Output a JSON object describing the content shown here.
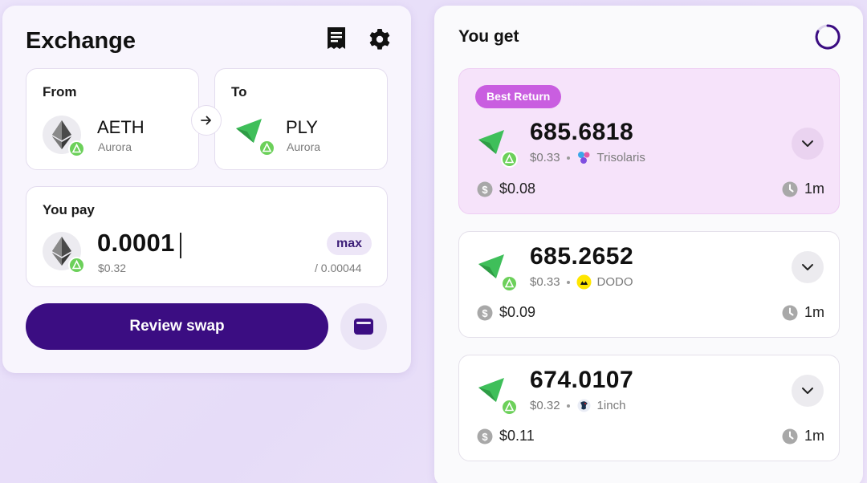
{
  "exchange": {
    "title": "Exchange",
    "from": {
      "label": "From",
      "symbol": "AETH",
      "chain": "Aurora"
    },
    "to": {
      "label": "To",
      "symbol": "PLY",
      "chain": "Aurora"
    },
    "pay": {
      "label": "You pay",
      "amount": "0.0001",
      "usd": "$0.32",
      "max_label": "max",
      "balance": "/ 0.00044"
    },
    "review_label": "Review swap"
  },
  "you_get": {
    "title": "You get",
    "best_label": "Best Return",
    "routes": [
      {
        "amount": "685.6818",
        "usd": "$0.33",
        "dex": "Trisolaris",
        "fee": "$0.08",
        "time": "1m"
      },
      {
        "amount": "685.2652",
        "usd": "$0.33",
        "dex": "DODO",
        "fee": "$0.09",
        "time": "1m"
      },
      {
        "amount": "674.0107",
        "usd": "$0.32",
        "dex": "1inch",
        "fee": "$0.11",
        "time": "1m"
      }
    ]
  },
  "colors": {
    "primary": "#3b0d82",
    "best_bg": "#f6e3fa",
    "best_badge": "#c95ee0",
    "chain_badge": "#6cd05a",
    "ply_green": "#3fbf5a"
  },
  "icons": [
    "receipt-icon",
    "gear-icon",
    "eth-icon",
    "ply-icon",
    "aurora-icon",
    "arrow-right-icon",
    "wallet-icon",
    "spinner-icon",
    "chevron-down-icon",
    "coin-icon",
    "clock-icon",
    "trisolaris-icon",
    "dodo-icon",
    "oneinch-icon"
  ]
}
